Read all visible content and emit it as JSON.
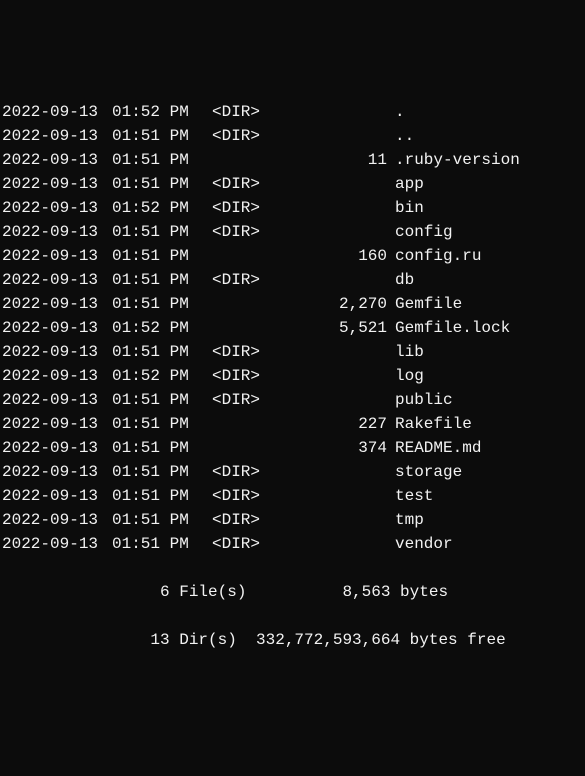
{
  "entries": [
    {
      "date": "2022-09-13",
      "time": "01:52 PM",
      "dir": "<DIR>",
      "size": "",
      "name": "."
    },
    {
      "date": "2022-09-13",
      "time": "01:51 PM",
      "dir": "<DIR>",
      "size": "",
      "name": ".."
    },
    {
      "date": "2022-09-13",
      "time": "01:51 PM",
      "dir": "",
      "size": "11",
      "name": ".ruby-version"
    },
    {
      "date": "2022-09-13",
      "time": "01:51 PM",
      "dir": "<DIR>",
      "size": "",
      "name": "app"
    },
    {
      "date": "2022-09-13",
      "time": "01:52 PM",
      "dir": "<DIR>",
      "size": "",
      "name": "bin"
    },
    {
      "date": "2022-09-13",
      "time": "01:51 PM",
      "dir": "<DIR>",
      "size": "",
      "name": "config"
    },
    {
      "date": "2022-09-13",
      "time": "01:51 PM",
      "dir": "",
      "size": "160",
      "name": "config.ru"
    },
    {
      "date": "2022-09-13",
      "time": "01:51 PM",
      "dir": "<DIR>",
      "size": "",
      "name": "db"
    },
    {
      "date": "2022-09-13",
      "time": "01:51 PM",
      "dir": "",
      "size": "2,270",
      "name": "Gemfile"
    },
    {
      "date": "2022-09-13",
      "time": "01:52 PM",
      "dir": "",
      "size": "5,521",
      "name": "Gemfile.lock"
    },
    {
      "date": "2022-09-13",
      "time": "01:51 PM",
      "dir": "<DIR>",
      "size": "",
      "name": "lib"
    },
    {
      "date": "2022-09-13",
      "time": "01:52 PM",
      "dir": "<DIR>",
      "size": "",
      "name": "log"
    },
    {
      "date": "2022-09-13",
      "time": "01:51 PM",
      "dir": "<DIR>",
      "size": "",
      "name": "public"
    },
    {
      "date": "2022-09-13",
      "time": "01:51 PM",
      "dir": "",
      "size": "227",
      "name": "Rakefile"
    },
    {
      "date": "2022-09-13",
      "time": "01:51 PM",
      "dir": "",
      "size": "374",
      "name": "README.md"
    },
    {
      "date": "2022-09-13",
      "time": "01:51 PM",
      "dir": "<DIR>",
      "size": "",
      "name": "storage"
    },
    {
      "date": "2022-09-13",
      "time": "01:51 PM",
      "dir": "<DIR>",
      "size": "",
      "name": "test"
    },
    {
      "date": "2022-09-13",
      "time": "01:51 PM",
      "dir": "<DIR>",
      "size": "",
      "name": "tmp"
    },
    {
      "date": "2022-09-13",
      "time": "01:51 PM",
      "dir": "<DIR>",
      "size": "",
      "name": "vendor"
    }
  ],
  "summary": {
    "files_line": "     6 File(s)          8,563 bytes",
    "dirs_line": "    13 Dir(s)  332,772,593,664 bytes free"
  }
}
